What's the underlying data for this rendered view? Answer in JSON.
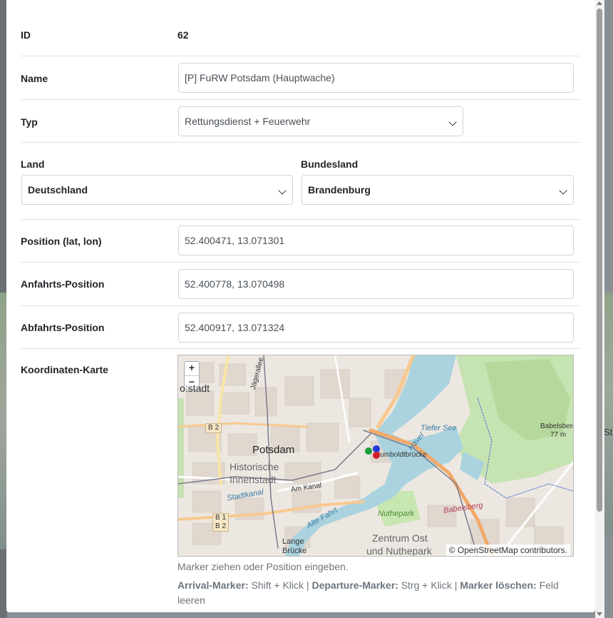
{
  "form": {
    "id_label": "ID",
    "id_value": "62",
    "name_label": "Name",
    "name_value": "[P] FuRW Potsdam (Hauptwache)",
    "type_label": "Typ",
    "type_value": "Rettungsdienst + Feuerwehr",
    "country_label": "Land",
    "country_value": "Deutschland",
    "state_label": "Bundesland",
    "state_value": "Brandenburg",
    "position_label": "Position (lat, lon)",
    "position_value": "52.400471, 13.071301",
    "arrival_label": "Anfahrts-Position",
    "arrival_value": "52.400778, 13.070498",
    "departure_label": "Abfahrts-Position",
    "departure_value": "52.400917, 13.071324",
    "map_label": "Koordinaten-Karte"
  },
  "map": {
    "zoom_in": "+",
    "zoom_out": "−",
    "attribution": "© OpenStreetMap contributors.",
    "labels": {
      "potsdam": "Potsdam",
      "historische": "Historische",
      "innenstadt": "Innenstadt",
      "tiefer_see": "Tiefer See",
      "havel": "Havel",
      "humboldtbruecke": "Humboldtbrücke",
      "babelsberg_hill": "Babelsberg",
      "babelsberg_height": "77 m",
      "babelsberg": "Babelsberg",
      "nuthepark": "Nuthepark",
      "zentrum_ost": "Zentrum Ost",
      "und_nuthepark": "und Nuthepark",
      "lange": "Lange",
      "bruecke": "Brücke",
      "am_kanal": "Am Kanal",
      "stadtkanal": "Stadtkanal",
      "alte_fahrt": "Alte Fahrt",
      "jaegerallee": "Jägerallee",
      "vorstadt": "o:stadt",
      "b2": "B 2",
      "b1": "B 1",
      "b2b": "B 2"
    },
    "marker_colors": {
      "position": "#d11f2a",
      "arrival": "#1c9d3c",
      "departure": "#2038d8"
    }
  },
  "hints": {
    "line1": "Marker ziehen oder Position eingeben.",
    "arrival_key": "Arrival-Marker:",
    "arrival_text": "Shift + Klick |",
    "departure_key": "Departure-Marker:",
    "departure_text": "Strg + Klick |",
    "delete_key": "Marker löschen:",
    "delete_text": "Feld leeren"
  },
  "background": {
    "edge_text": "St"
  }
}
